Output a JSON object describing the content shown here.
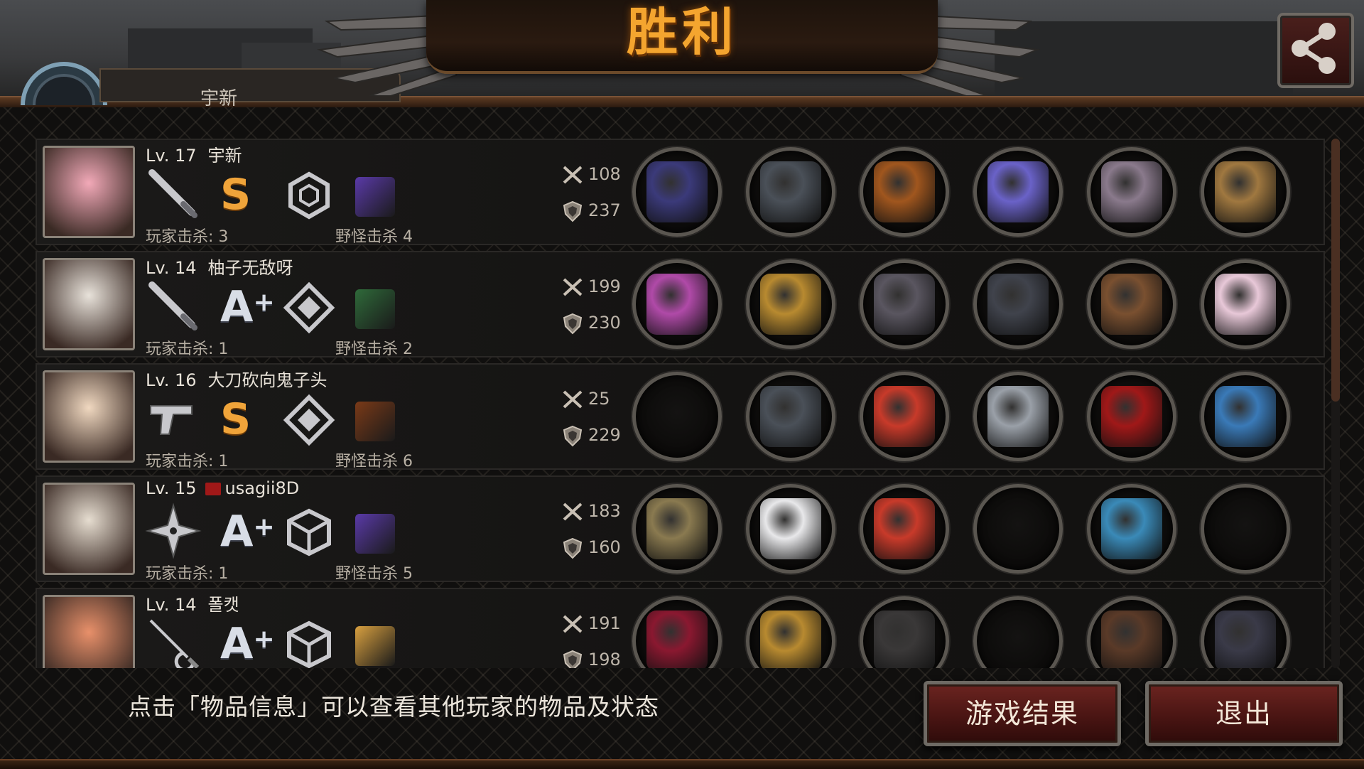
{
  "title": "胜利",
  "profile": {
    "name": "宇新"
  },
  "players": [
    {
      "level": "Lv. 17",
      "name": "宇新",
      "rank": "S",
      "rank_plus": "",
      "weapon_icon": "baseball-bat-icon",
      "emblem_icon": "hexagon-emblem-icon",
      "player_kills": "玩家击杀: 3",
      "monster_kills": "野怪击杀 4",
      "attack": "108",
      "defense": "237",
      "avatar_color": "#f2a9b8",
      "pet_color": "#5a3aa8",
      "flag": false,
      "items": [
        "purple-revolver-icon",
        "knight-helmet-icon",
        "bronze-armor-icon",
        "lightning-gauntlet-icon",
        "leather-boots-icon",
        "cardboard-box-icon"
      ],
      "item_colors": [
        "#3b3a7a",
        "#4a5058",
        "#a0561e",
        "#6a62c8",
        "#8a7a8c",
        "#a07840"
      ]
    },
    {
      "level": "Lv. 14",
      "name": "柚子无敌呀",
      "rank": "A",
      "rank_plus": "+",
      "weapon_icon": "baseball-bat-icon",
      "emblem_icon": "diamond-emblem-icon",
      "player_kills": "玩家击杀: 1",
      "monster_kills": "野怪击杀 2",
      "attack": "199",
      "defense": "230",
      "avatar_color": "#e8e2da",
      "pet_color": "#2f6a3a",
      "flag": false,
      "items": [
        "magic-wand-icon",
        "gold-helmet-icon",
        "stone-armor-icon",
        "spiked-gauntlet-icon",
        "ammo-belt-icon",
        "pearl-icon"
      ],
      "item_colors": [
        "#b04aa8",
        "#b88a30",
        "#5a5660",
        "#40434c",
        "#7a5030",
        "#e8c8d8"
      ]
    },
    {
      "level": "Lv. 16",
      "name": "大刀砍向鬼子头",
      "rank": "S",
      "rank_plus": "",
      "weapon_icon": "pistol-icon",
      "emblem_icon": "diamond-emblem-icon",
      "player_kills": "玩家击杀: 1",
      "monster_kills": "野怪击杀 6",
      "attack": "25",
      "defense": "229",
      "avatar_color": "#f0d8c0",
      "pet_color": "#7a3a18",
      "flag": false,
      "items": [
        "",
        "knight-helmet-icon",
        "red-jacket-icon",
        "steel-bracer-icon",
        "red-heels-icon",
        "sapphire-bracelet-icon"
      ],
      "item_colors": [
        "",
        "#4a5058",
        "#c83a2a",
        "#9aa0a8",
        "#a01818",
        "#3a7ab8"
      ]
    },
    {
      "level": "Lv. 15",
      "name": "usagii8D",
      "rank": "A",
      "rank_plus": "+",
      "weapon_icon": "shuriken-icon",
      "emblem_icon": "cube-emblem-icon",
      "player_kills": "玩家击杀: 1",
      "monster_kills": "野怪击杀 5",
      "attack": "183",
      "defense": "160",
      "avatar_color": "#e6ddd0",
      "pet_color": "#5a3aa8",
      "flag": true,
      "items": [
        "bronze-shield-icon",
        "racing-helmet-icon",
        "red-jacket-icon",
        "",
        "running-shoes-icon",
        ""
      ],
      "item_colors": [
        "#8a7a50",
        "#e8e8ea",
        "#c83a2a",
        "",
        "#3a8ab8",
        ""
      ]
    },
    {
      "level": "Lv. 14",
      "name": "폴캣",
      "rank": "A",
      "rank_plus": "+",
      "weapon_icon": "rapier-icon",
      "emblem_icon": "cube-emblem-icon",
      "player_kills": "",
      "monster_kills": "",
      "attack": "191",
      "defense": "198",
      "avatar_color": "#e8906a",
      "pet_color": "#d8a040",
      "flag": false,
      "items": [
        "crimson-blade-icon",
        "gold-helmet-icon",
        "leather-coat-icon",
        "",
        "brown-boots-icon",
        "battle-flag-icon"
      ],
      "item_colors": [
        "#8a1830",
        "#b88a30",
        "#3a3838",
        "",
        "#5a3a28",
        "#3a3a48"
      ]
    }
  ],
  "hint": "点击「物品信息」可以查看其他玩家的物品及状态",
  "buttons": {
    "result": "游戏结果",
    "exit": "退出"
  },
  "colors": {
    "title": "#f4a52f",
    "button_bg": "#4a1513",
    "frame": "#6b4a2a"
  }
}
